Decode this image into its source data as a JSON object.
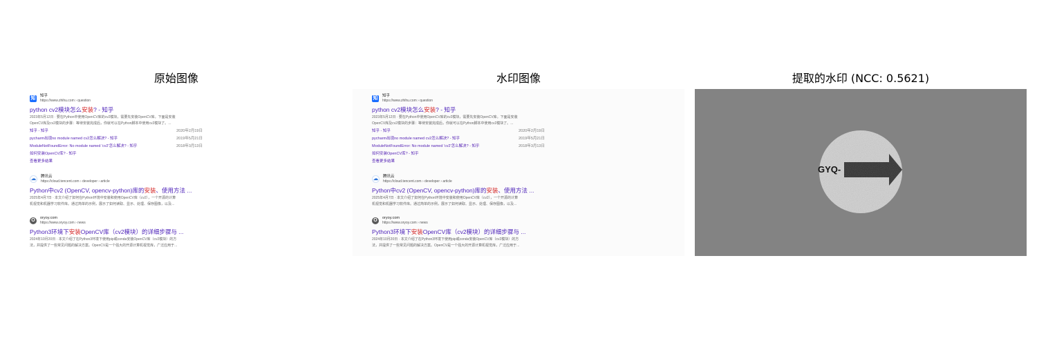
{
  "panels": {
    "original_title": "原始图像",
    "watermarked_title": "水印图像",
    "extracted_title": "提取的水印 (NCC: 0.5621)"
  },
  "serp": {
    "results": [
      {
        "source": "知乎",
        "url": "https://www.zhihu.com › question",
        "icon": "zhihu-icon",
        "title_pre": "python cv2模块怎么",
        "title_hl": "安装",
        "title_post": "? - 知乎",
        "snippet1": "2023年5月12日 · 要在Python中使用OpenCV库的cv2模块，需要先安装OpenCV库。下面是安装",
        "snippet2": "OpenCV库及cv2模块的步骤：等待安装完成后，你就可以在Python脚本中使用cv2模块了。...",
        "sublinks": [
          {
            "label": "知乎 - 知乎",
            "date": "2020年2月19日"
          },
          {
            "label": "pycharm出现no module named cv2怎么解决? - 知乎",
            "date": "2019年5月21日"
          },
          {
            "label": "ModuleNotFoundError: No module named 'cv2'怎么解决? - 知乎",
            "date": "2018年3月13日"
          },
          {
            "label": "如何安装OpenCV库? - 知乎",
            "date": ""
          }
        ],
        "more": "查看更多结果"
      },
      {
        "source": "腾讯云",
        "url": "https://cloud.tencent.com › developer › article",
        "icon": "cloud-icon",
        "title_pre": "Python中cv2 (OpenCV, opencv-python)库的",
        "title_hl": "安装",
        "title_post": "、使用方法 ...",
        "snippet1": "2025年4月7日 · 本文介绍了如何在Python环境中安装和使用OpenCV库（cv2），一个开源的计算",
        "snippet2": "机视觉和机器学习软件库。通过简单的示例，展示了如何读取、显示、处理、保存图像，以及..."
      },
      {
        "source": "oryoy.com",
        "url": "https://www.oryoy.com › news",
        "icon": "oryoy-icon",
        "title_pre": "Python3环境下",
        "title_hl": "安装",
        "title_post": "OpenCV库（cv2模块）的详细步骤与 ...",
        "snippet1": "2024年10月20日 · 本文介绍了在Python3环境下使用pip或conda安装OpenCV库（cv2模块）的方",
        "snippet2": "法，并提供了一些常见问题的解决方案。OpenCV是一个强大的开源计算机视觉库，广泛应用于..."
      }
    ]
  },
  "watermark": {
    "text": "GYQ-",
    "background_color": "#838383",
    "disc_color": "#d2d2d2",
    "arrow_color": "#2a2a2a"
  }
}
